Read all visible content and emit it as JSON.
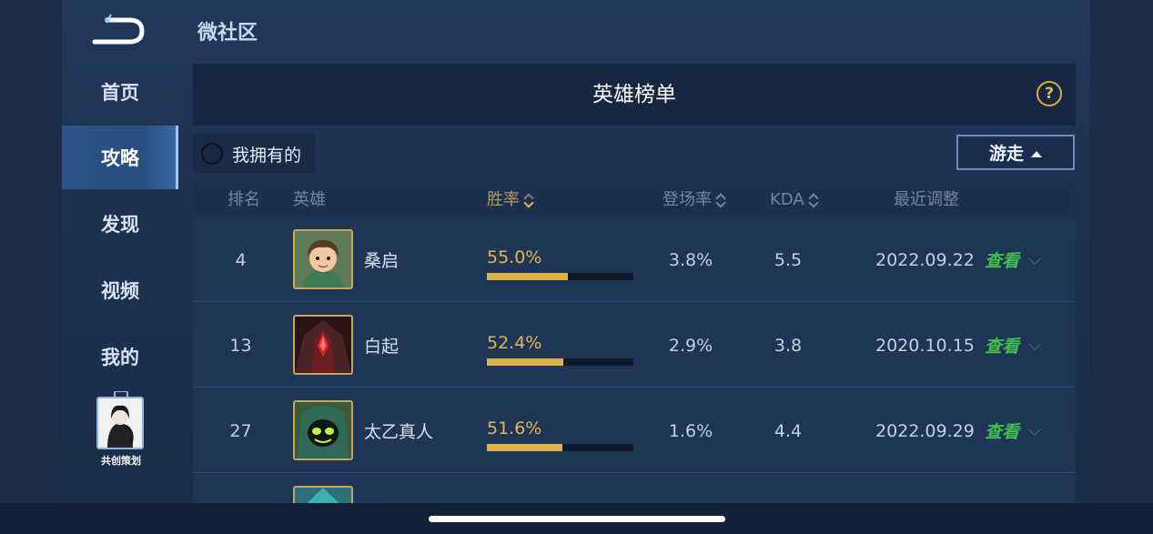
{
  "page": {
    "title": "微社区"
  },
  "sidebar": {
    "items": [
      {
        "label": "首页"
      },
      {
        "label": "攻略"
      },
      {
        "label": "发现"
      },
      {
        "label": "视频"
      },
      {
        "label": "我的"
      }
    ],
    "active_index": 1,
    "cocreate_label": "共创策划"
  },
  "panel": {
    "title": "英雄榜单",
    "help_icon": "?",
    "owned_filter_label": "我拥有的",
    "role_dropdown_label": "游走"
  },
  "table": {
    "headers": {
      "rank": "排名",
      "hero": "英雄",
      "winrate": "胜率",
      "pickrate": "登场率",
      "kda": "KDA",
      "updated": "最近调整"
    },
    "rows": [
      {
        "rank": "4",
        "hero": "桑启",
        "winrate": "55.0%",
        "winrate_value": 55.0,
        "pickrate": "3.8%",
        "kda": "5.5",
        "updated": "2022.09.22",
        "action": "查看"
      },
      {
        "rank": "13",
        "hero": "白起",
        "winrate": "52.4%",
        "winrate_value": 52.4,
        "pickrate": "2.9%",
        "kda": "3.8",
        "updated": "2020.10.15",
        "action": "查看"
      },
      {
        "rank": "27",
        "hero": "太乙真人",
        "winrate": "51.6%",
        "winrate_value": 51.6,
        "pickrate": "1.6%",
        "kda": "4.4",
        "updated": "2022.09.29",
        "action": "查看"
      }
    ]
  },
  "colors": {
    "accent_gold": "#e0b84f",
    "link_green": "#3fbf4f",
    "active_nav": "#2c5286"
  }
}
